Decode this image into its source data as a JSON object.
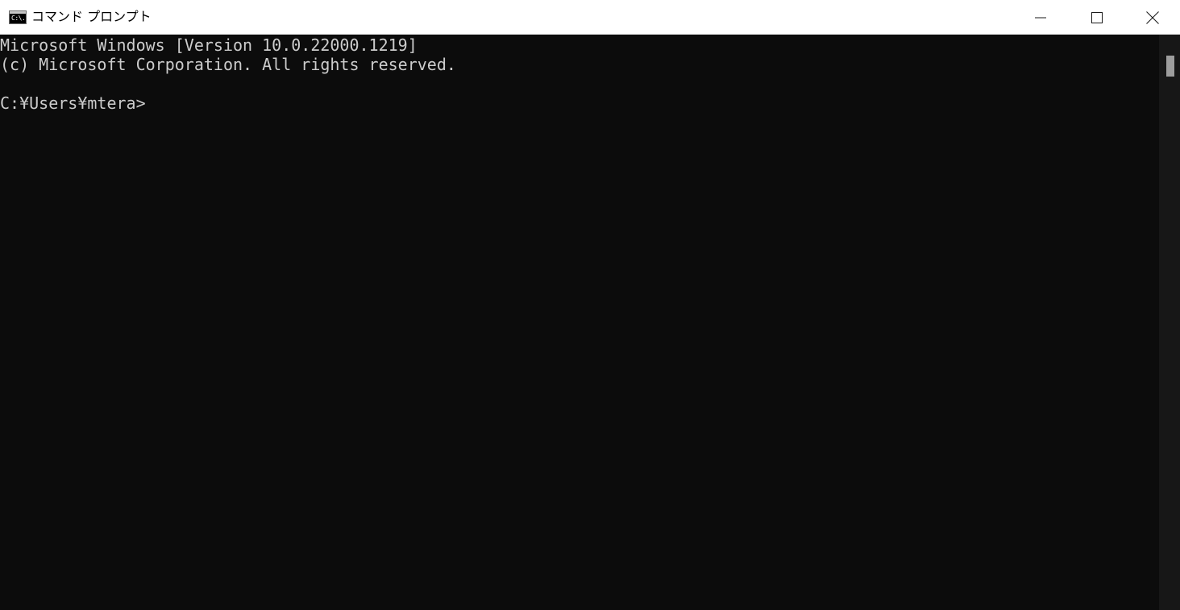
{
  "window": {
    "title": "コマンド プロンプト",
    "icon": "cmd-app-icon",
    "icon_glyph": "C:\\."
  },
  "caption_buttons": {
    "minimize": "minimize-icon",
    "maximize": "maximize-icon",
    "close": "close-icon"
  },
  "console": {
    "lines": [
      "Microsoft Windows [Version 10.0.22000.1219]",
      "(c) Microsoft Corporation. All rights reserved.",
      "",
      "C:¥Users¥mtera>"
    ]
  },
  "colors": {
    "console_background": "#0c0c0c",
    "console_text": "#cccccc",
    "titlebar_background": "#ffffff",
    "scrollbar_thumb": "#9d9d9d"
  }
}
